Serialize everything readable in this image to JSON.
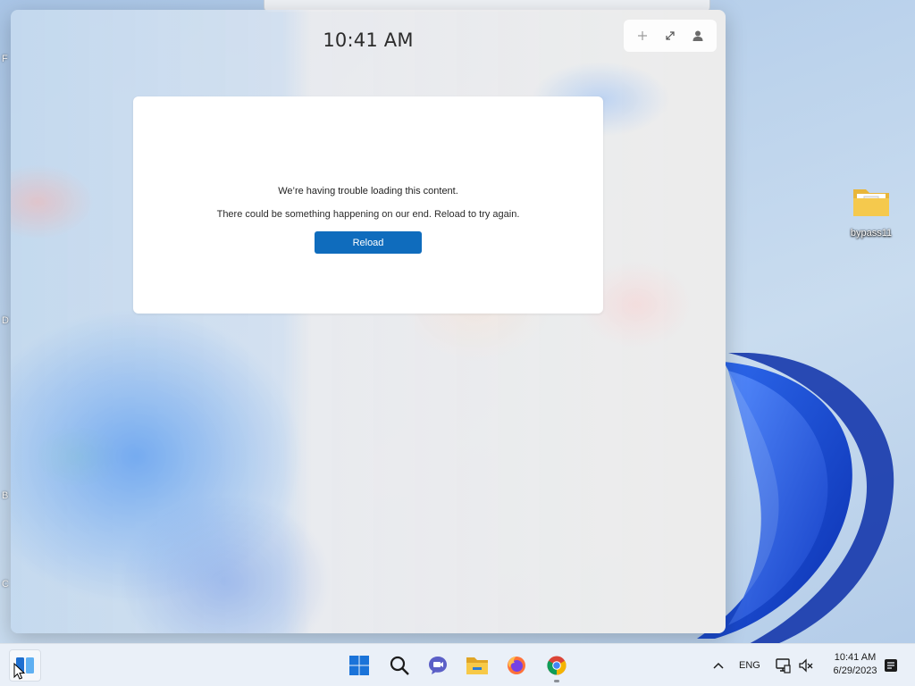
{
  "desktop": {
    "edge_letters": [
      "F",
      "D",
      "B",
      "C"
    ],
    "icons": [
      {
        "label": "bypass11",
        "icon": "folder-icon"
      }
    ]
  },
  "widgets": {
    "clock": "10:41 AM",
    "toolbar": {
      "add_icon": "plus-icon",
      "expand_icon": "expand-icon",
      "profile_icon": "person-icon"
    },
    "error": {
      "title": "We’re having trouble loading this content.",
      "message": "There could be something happening on our end. Reload to try again.",
      "button_label": "Reload"
    }
  },
  "taskbar": {
    "pinned": [
      {
        "name": "start",
        "icon": "windows-logo-icon"
      },
      {
        "name": "search",
        "icon": "search-icon"
      },
      {
        "name": "teams-chat",
        "icon": "chat-icon"
      },
      {
        "name": "file-explorer",
        "icon": "folder-icon"
      },
      {
        "name": "firefox",
        "icon": "firefox-icon"
      },
      {
        "name": "chrome",
        "icon": "chrome-icon"
      }
    ],
    "tray": {
      "overflow_icon": "chevron-up-icon",
      "language": "ENG",
      "network_icon": "network-icon",
      "volume_icon": "volume-muted-icon",
      "time": "10:41 AM",
      "date": "6/29/2023",
      "notification_icon": "notification-icon"
    }
  },
  "colors": {
    "accent": "#0f6cbd",
    "taskbar": "#eaf0f8",
    "bloom": "#1a4fd6"
  }
}
